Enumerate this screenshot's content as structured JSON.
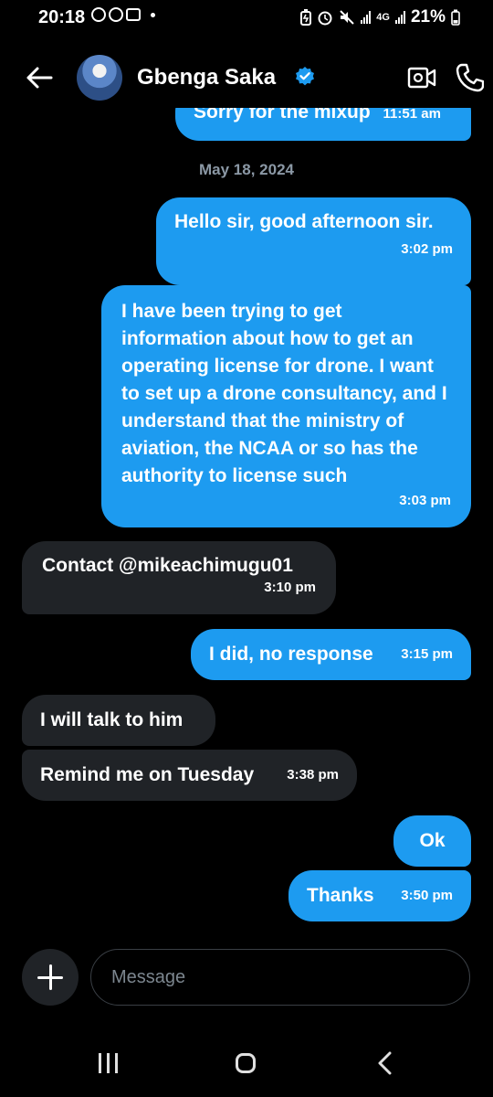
{
  "status_bar": {
    "time": "20:18",
    "network": "4G",
    "battery": "21%"
  },
  "header": {
    "contact_name": "Gbenga Saka",
    "verified": true
  },
  "conversation": {
    "date_separator": "May 18, 2024",
    "messages": [
      {
        "direction": "sent",
        "text": "Sorry for the mixup",
        "time": "11:51 am",
        "partially_visible": true
      },
      {
        "direction": "sent",
        "text": "Hello sir, good afternoon sir.",
        "time": "3:02 pm"
      },
      {
        "direction": "sent",
        "text": "I have been trying to get information about how to get an operating license for drone. I want to set up a drone consultancy, and I understand that the ministry of aviation, the NCAA or so has the authority to license such",
        "time": "3:03 pm"
      },
      {
        "direction": "received",
        "text": "Contact @mikeachimugu01",
        "time": "3:10 pm"
      },
      {
        "direction": "sent",
        "text": "I did, no response",
        "time": "3:15 pm"
      },
      {
        "direction": "received",
        "text": "I will talk to him",
        "time": ""
      },
      {
        "direction": "received",
        "text": "Remind me on Tuesday",
        "time": "3:38 pm"
      },
      {
        "direction": "sent",
        "text": "Ok",
        "time": ""
      },
      {
        "direction": "sent",
        "text": "Thanks",
        "time": "3:50 pm"
      }
    ]
  },
  "composer": {
    "placeholder": "Message"
  },
  "colors": {
    "background": "#000000",
    "sent_bubble": "#1d9bf0",
    "received_bubble": "#202327",
    "verified_badge": "#1d9bf0"
  }
}
